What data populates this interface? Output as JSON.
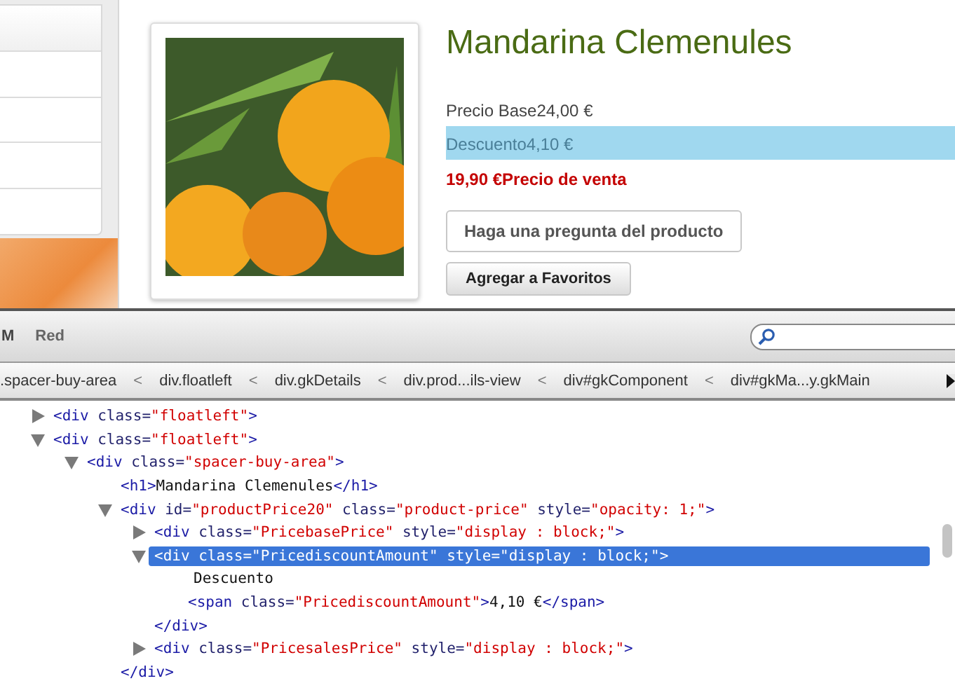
{
  "page": {
    "product": {
      "title": "Mandarina Clemenules",
      "prices": [
        {
          "kind": "base",
          "label": "Precio Base",
          "value": "24,00 €",
          "highlighted": false
        },
        {
          "kind": "discount",
          "label": "Descuento",
          "value": "4,10 €",
          "highlighted": true
        },
        {
          "kind": "sale",
          "value": "19,90 €",
          "label": "Precio de venta",
          "highlighted": false
        }
      ],
      "buttons": [
        {
          "label": "Haga una pregunta del producto",
          "kind": "plain"
        },
        {
          "label": "Agregar a Favoritos",
          "kind": "gradient"
        }
      ]
    }
  },
  "devtools": {
    "toolbar": {
      "tabs": [
        {
          "label": "M",
          "selected": false
        },
        {
          "label": "Red",
          "selected": false
        }
      ]
    },
    "breadcrumbs": [
      {
        "label": ".spacer-buy-area"
      },
      {
        "label": "div.floatleft"
      },
      {
        "label": "div.gkDetails"
      },
      {
        "label": "div.prod...ils-view"
      },
      {
        "label": "div#gkComponent"
      },
      {
        "label": "div#gkMa...y.gkMain"
      }
    ],
    "breadcrumb_separator": "<",
    "tree": [
      {
        "kind": "element",
        "expanded": false,
        "selected": false,
        "tokens": [
          {
            "kind": "tag",
            "text": "<div"
          },
          {
            "kind": "attr",
            "text": "class="
          },
          {
            "kind": "value",
            "text": "\"floatleft\""
          },
          {
            "kind": "tag",
            "text": ">"
          }
        ]
      },
      {
        "kind": "element",
        "expanded": true,
        "selected": false,
        "tokens": [
          {
            "kind": "tag",
            "text": "<div"
          },
          {
            "kind": "attr",
            "text": "class="
          },
          {
            "kind": "value",
            "text": "\"floatleft\""
          },
          {
            "kind": "tag",
            "text": ">"
          }
        ],
        "children": [
          {
            "kind": "element",
            "expanded": true,
            "selected": false,
            "tokens": [
              {
                "kind": "tag",
                "text": "<div"
              },
              {
                "kind": "attr",
                "text": "class="
              },
              {
                "kind": "value",
                "text": "\"spacer-buy-area\""
              },
              {
                "kind": "tag",
                "text": ">"
              }
            ],
            "children": [
              {
                "kind": "line",
                "tokens": [
                  {
                    "kind": "tag",
                    "text": "<h1>"
                  },
                  {
                    "kind": "text",
                    "text": "Mandarina Clemenules"
                  },
                  {
                    "kind": "tag",
                    "text": "</h1>"
                  }
                ]
              },
              {
                "kind": "element",
                "expanded": true,
                "selected": false,
                "tokens": [
                  {
                    "kind": "tag",
                    "text": "<div"
                  },
                  {
                    "kind": "attr",
                    "text": "id="
                  },
                  {
                    "kind": "value",
                    "text": "\"productPrice20\""
                  },
                  {
                    "kind": "attr",
                    "text": "class="
                  },
                  {
                    "kind": "value",
                    "text": "\"product-price\""
                  },
                  {
                    "kind": "attr",
                    "text": "style="
                  },
                  {
                    "kind": "value",
                    "text": "\"opacity: 1;\""
                  },
                  {
                    "kind": "tag",
                    "text": ">"
                  }
                ],
                "children": [
                  {
                    "kind": "element",
                    "expanded": false,
                    "selected": false,
                    "tokens": [
                      {
                        "kind": "tag",
                        "text": "<div"
                      },
                      {
                        "kind": "attr",
                        "text": "class="
                      },
                      {
                        "kind": "value",
                        "text": "\"PricebasePrice\""
                      },
                      {
                        "kind": "attr",
                        "text": "style="
                      },
                      {
                        "kind": "value",
                        "text": "\"display : block;\""
                      },
                      {
                        "kind": "tag",
                        "text": ">"
                      }
                    ]
                  },
                  {
                    "kind": "element",
                    "expanded": true,
                    "selected": true,
                    "tokens": [
                      {
                        "kind": "tag",
                        "text": "<div"
                      },
                      {
                        "kind": "attr",
                        "text": "class="
                      },
                      {
                        "kind": "value",
                        "text": "\"PricediscountAmount\""
                      },
                      {
                        "kind": "attr",
                        "text": "style="
                      },
                      {
                        "kind": "value",
                        "text": "\"display : block;\""
                      },
                      {
                        "kind": "tag",
                        "text": ">"
                      }
                    ],
                    "children": [
                      {
                        "kind": "line",
                        "tokens": [
                          {
                            "kind": "text",
                            "text": "Descuento"
                          }
                        ]
                      },
                      {
                        "kind": "line",
                        "tokens": [
                          {
                            "kind": "tag",
                            "text": "<span"
                          },
                          {
                            "kind": "attr",
                            "text": "class="
                          },
                          {
                            "kind": "value",
                            "text": "\"PricediscountAmount\""
                          },
                          {
                            "kind": "tag",
                            "text": ">"
                          },
                          {
                            "kind": "text",
                            "text": "4,10 €"
                          },
                          {
                            "kind": "tag",
                            "text": "</span>"
                          }
                        ]
                      }
                    ]
                  },
                  {
                    "kind": "line",
                    "tokens": [
                      {
                        "kind": "tag",
                        "text": "</div>"
                      }
                    ]
                  },
                  {
                    "kind": "element",
                    "expanded": false,
                    "selected": false,
                    "tokens": [
                      {
                        "kind": "tag",
                        "text": "<div"
                      },
                      {
                        "kind": "attr",
                        "text": "class="
                      },
                      {
                        "kind": "value",
                        "text": "\"PricesalesPrice\""
                      },
                      {
                        "kind": "attr",
                        "text": "style="
                      },
                      {
                        "kind": "value",
                        "text": "\"display : block;\""
                      },
                      {
                        "kind": "tag",
                        "text": ">"
                      }
                    ]
                  }
                ]
              },
              {
                "kind": "line",
                "tokens": [
                  {
                    "kind": "tag",
                    "text": "</div>"
                  }
                ]
              }
            ]
          }
        ]
      }
    ]
  }
}
